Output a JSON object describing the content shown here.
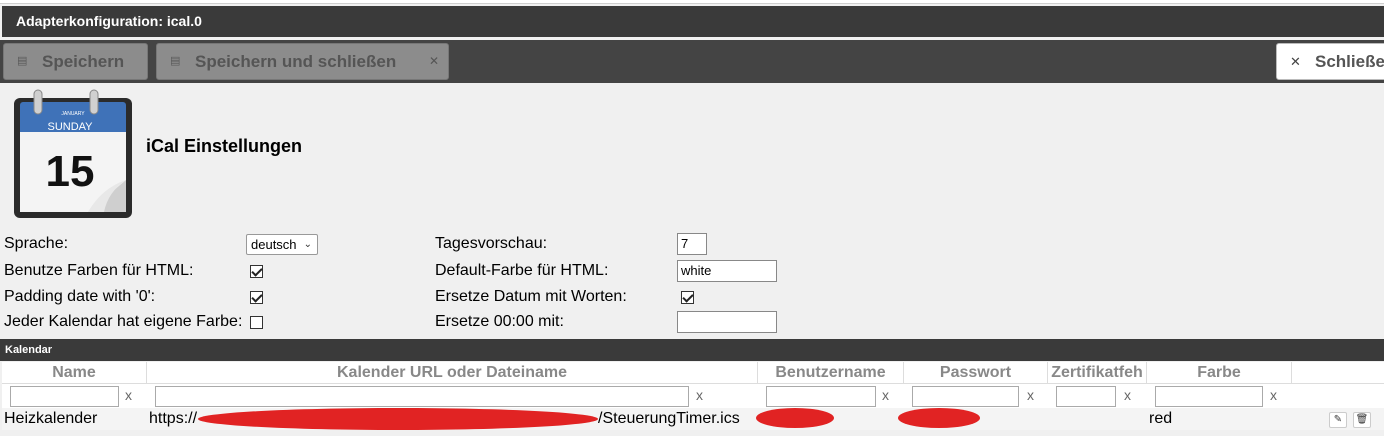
{
  "window": {
    "title": "Adapterkonfiguration: ical.0"
  },
  "toolbar": {
    "save_label": "Speichern",
    "save_close_label": "Speichern und schließen",
    "close_label": "Schließen",
    "save_icon": "floppy-icon",
    "close_icon": "x-icon"
  },
  "header": {
    "title": "iCal Einstellungen",
    "logo_month": "JANUARY",
    "logo_day": "SUNDAY",
    "logo_date": "15"
  },
  "settings": {
    "language_label": "Sprache:",
    "language_value": "deutsch",
    "use_colors_label": "Benutze Farben für HTML:",
    "use_colors_checked": true,
    "padding_label": "Padding date with '0':",
    "padding_checked": true,
    "own_color_label": "Jeder Kalendar hat eigene Farbe:",
    "own_color_checked": false,
    "preview_days_label": "Tagesvorschau:",
    "preview_days_value": "7",
    "default_color_label": "Default-Farbe für HTML:",
    "default_color_value": "white",
    "replace_date_label": "Ersetze Datum mit Worten:",
    "replace_date_checked": true,
    "replace_midnight_label": "Ersetze 00:00 mit:",
    "replace_midnight_value": ""
  },
  "calendars": {
    "section_title": "Kalendar",
    "columns": [
      "Name",
      "Kalender URL oder Dateiname",
      "Benutzername",
      "Passwort",
      "Zertifikatfeh",
      "Farbe"
    ],
    "filter_clear": "x",
    "rows": [
      {
        "name": "Heizkalender",
        "url_start": "https://",
        "url_end": "/SteuerungTimer.ics",
        "user": "",
        "password": "",
        "cert": "",
        "color": "red"
      }
    ]
  },
  "colors": {
    "titlebar": "#3a3a3a",
    "toolbar": "#444444",
    "redaction": "#e12323"
  }
}
